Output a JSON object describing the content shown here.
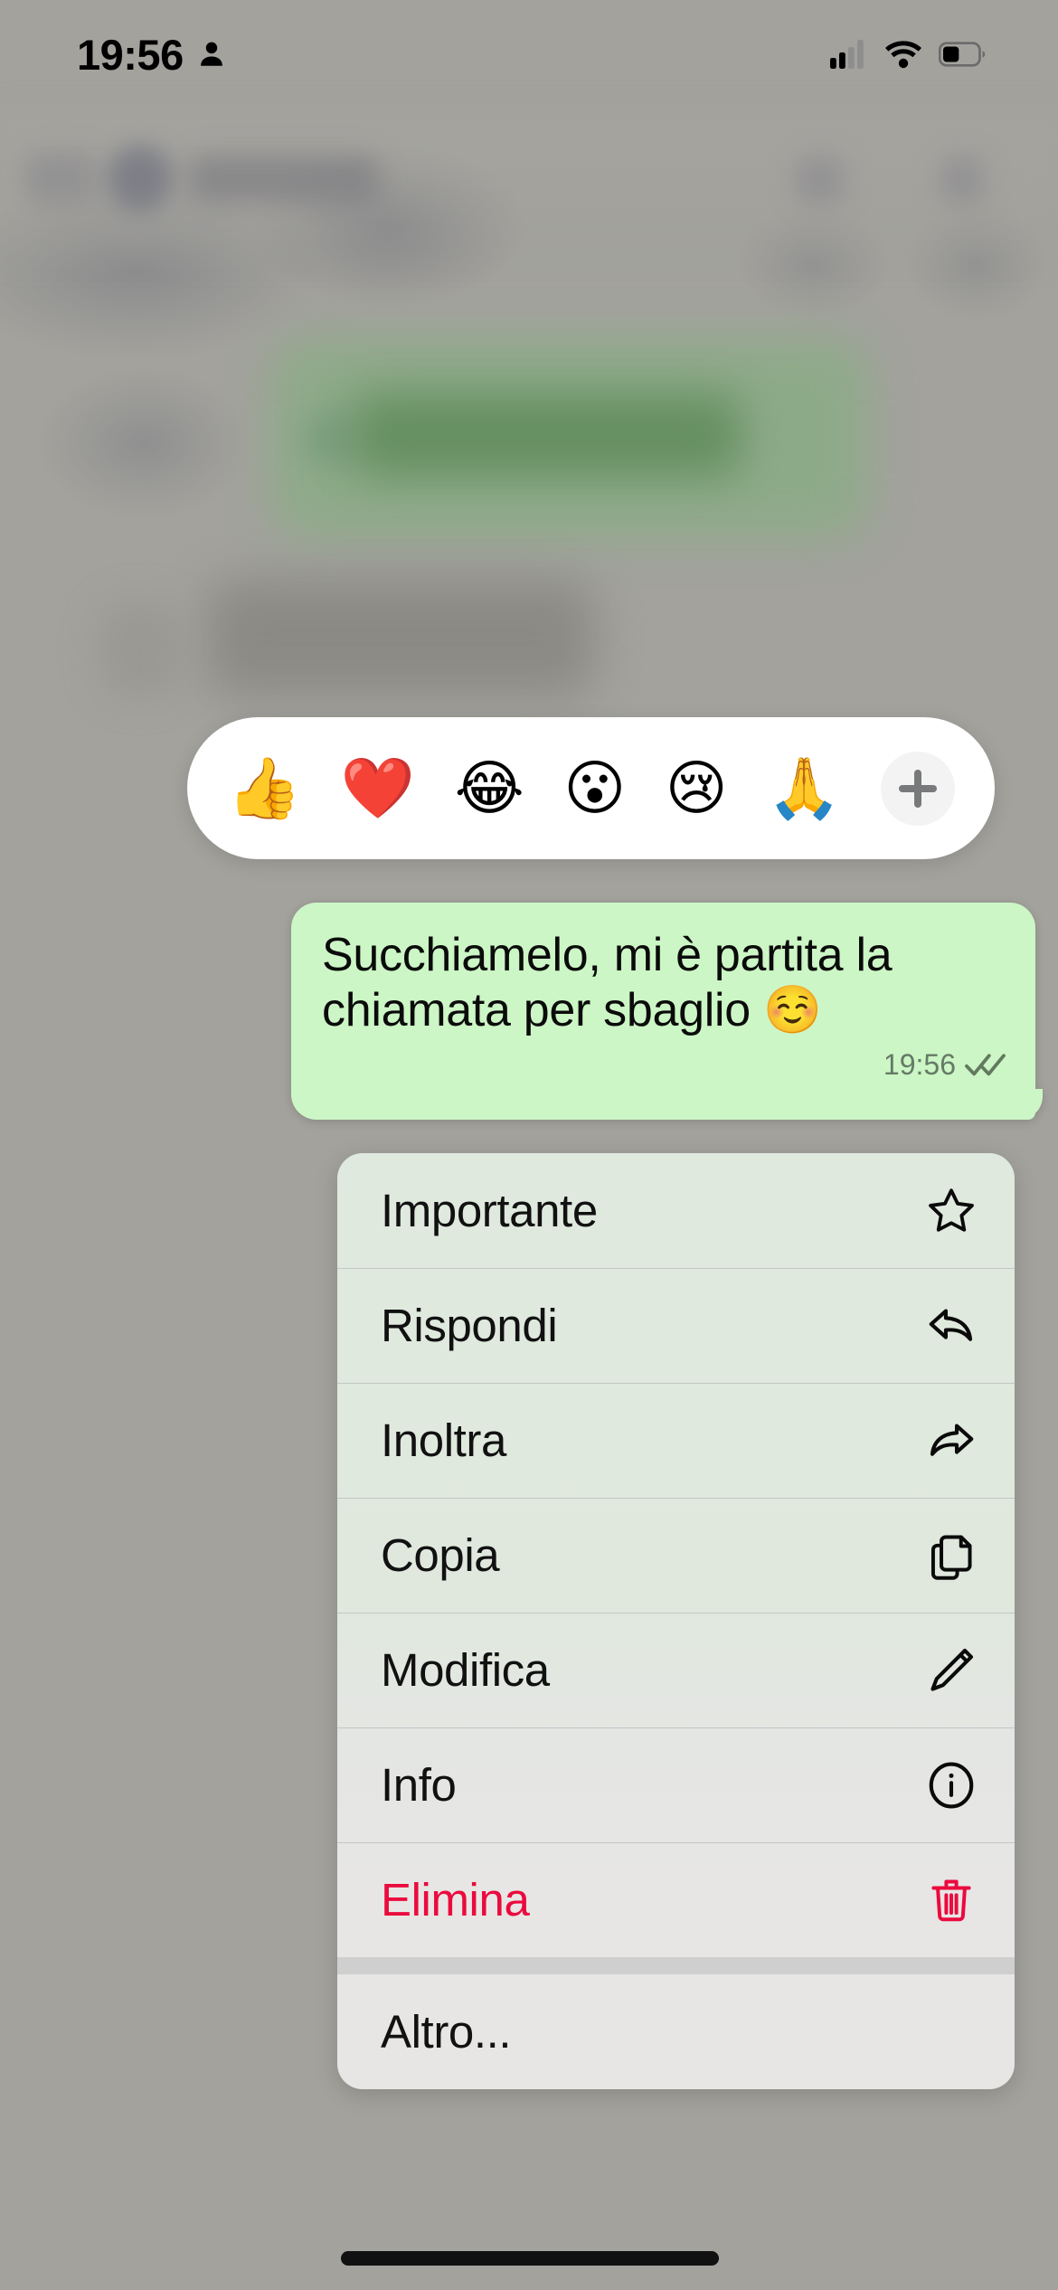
{
  "status_bar": {
    "time": "19:56",
    "person_icon": "person-icon",
    "cellular_icon": "cellular-signal-icon",
    "wifi_icon": "wifi-icon",
    "battery_icon": "battery-icon"
  },
  "reaction_bar": {
    "emojis": [
      {
        "name": "thumbs-up-reaction",
        "glyph": "👍"
      },
      {
        "name": "red-heart-reaction",
        "glyph": "❤️"
      },
      {
        "name": "tears-of-joy-reaction",
        "glyph": "😂"
      },
      {
        "name": "open-mouth-reaction",
        "glyph": "😮"
      },
      {
        "name": "crying-face-reaction",
        "glyph": "😢"
      },
      {
        "name": "folded-hands-reaction",
        "glyph": "🙏"
      }
    ],
    "add_label": "+"
  },
  "message": {
    "text": "Succhiamelo, mi è partita la chiamata per sbaglio ☺️",
    "time": "19:56",
    "status_icon": "double-check-icon",
    "bubble_color": "#ccf6c5",
    "outgoing": true
  },
  "context_menu": {
    "items": [
      {
        "label": "Importante",
        "icon": "star-icon",
        "destructive": false
      },
      {
        "label": "Rispondi",
        "icon": "reply-icon",
        "destructive": false
      },
      {
        "label": "Inoltra",
        "icon": "forward-icon",
        "destructive": false
      },
      {
        "label": "Copia",
        "icon": "copy-icon",
        "destructive": false
      },
      {
        "label": "Modifica",
        "icon": "pencil-icon",
        "destructive": false
      },
      {
        "label": "Info",
        "icon": "info-icon",
        "destructive": false
      },
      {
        "label": "Elimina",
        "icon": "trash-icon",
        "destructive": true
      },
      {
        "label": "Altro...",
        "icon": "",
        "destructive": false
      }
    ],
    "destructive_color": "#eb0a3e"
  },
  "home_indicator": "home-indicator"
}
